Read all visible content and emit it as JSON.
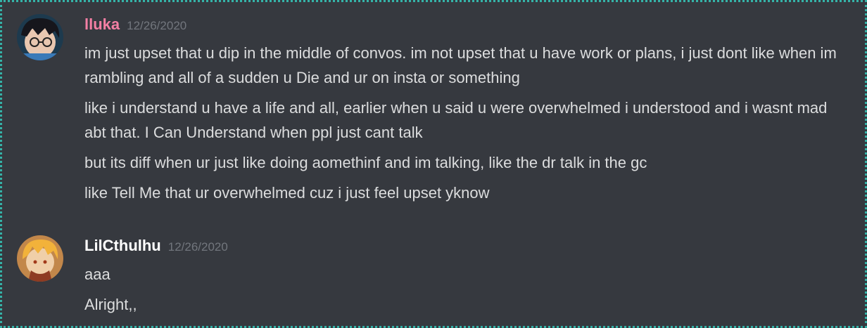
{
  "messages": [
    {
      "username": "lluka",
      "timestamp": "12/26/2020",
      "avatar": "anime-character-dark-hair-glasses-avatar",
      "lines": [
        "im just upset that u dip in the middle of convos. im not upset that u have work or plans, i just dont like when im rambling and all of a sudden u Die and ur on insta or something",
        "like i understand u have a life and all, earlier when u said u were overwhelmed i understood and i wasnt mad abt that. I Can Understand when ppl just cant talk",
        "but its diff when ur just like doing aomethinf and im talking, like the dr talk in the gc",
        "like Tell Me that ur overwhelmed cuz i just feel upset yknow"
      ]
    },
    {
      "username": "LilCthulhu",
      "timestamp": "12/26/2020",
      "avatar": "anime-character-blonde-hair-avatar",
      "lines": [
        "aaa",
        "Alright,,"
      ]
    }
  ],
  "colors": {
    "background": "#36393f",
    "text": "#dcddde",
    "timestamp": "#72767d",
    "username_lluka": "#f47fa4",
    "username_lilcthulhu": "#ffffff",
    "frame_border": "#35b3a8"
  }
}
